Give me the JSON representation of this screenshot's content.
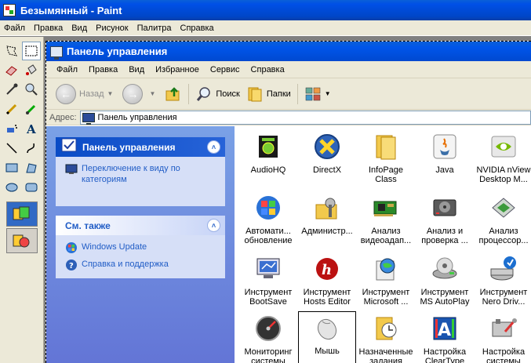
{
  "paint": {
    "title": "Безымянный - Paint",
    "menu": [
      "Файл",
      "Правка",
      "Вид",
      "Рисунок",
      "Палитра",
      "Справка"
    ]
  },
  "cp": {
    "title": "Панель управления",
    "menu": [
      "Файл",
      "Правка",
      "Вид",
      "Избранное",
      "Сервис",
      "Справка"
    ],
    "toolbar": {
      "back": "Назад",
      "search": "Поиск",
      "folders": "Папки"
    },
    "address": {
      "label": "Адрес:",
      "value": "Панель управления"
    },
    "side": {
      "panel1": {
        "title": "Панель управления",
        "task": "Переключение к виду по категориям"
      },
      "panel2": {
        "title": "См. также",
        "links": [
          "Windows Update",
          "Справка и поддержка"
        ]
      }
    },
    "items": [
      "AudioHQ",
      "DirectX",
      "InfoPage Class",
      "Java",
      "NVIDIA nView Desktop M...",
      "Автомати... обновление",
      "Администр...",
      "Анализ видеоадап...",
      "Анализ и проверка ...",
      "Анализ процессор...",
      "Инструмент BootSave",
      "Инструмент Hosts Editor",
      "Инструмент Microsoft ...",
      "Инструмент MS AutoPlay",
      "Инструмент Nero Driv...",
      "Мониторинг системы",
      "Мышь",
      "Назначенные задания",
      "Настройка ClearType",
      "Настройка системы"
    ],
    "icon_names": [
      "audiohq-icon",
      "directx-icon",
      "folder-icon",
      "java-icon",
      "nvidia-icon",
      "windows-update-icon",
      "admin-tools-icon",
      "video-card-icon",
      "hard-drive-icon",
      "processor-icon",
      "monitor-icon",
      "hosts-editor-icon",
      "globe-icon",
      "autoplay-icon",
      "nero-icon",
      "speedometer-icon",
      "mouse-icon",
      "scheduled-tasks-icon",
      "cleartype-icon",
      "system-tools-icon"
    ]
  }
}
